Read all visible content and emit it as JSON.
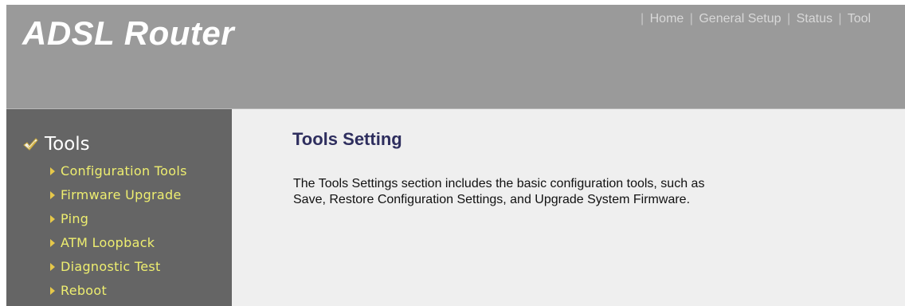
{
  "header": {
    "brand": "ADSL Router",
    "nav": [
      {
        "label": "Home"
      },
      {
        "label": "General Setup"
      },
      {
        "label": "Status"
      },
      {
        "label": "Tool"
      }
    ]
  },
  "sidebar": {
    "title": "Tools",
    "title_icon": "checkmark-icon",
    "item_icon": "arrow-right-icon",
    "items": [
      {
        "label": "Configuration Tools"
      },
      {
        "label": "Firmware Upgrade"
      },
      {
        "label": "Ping"
      },
      {
        "label": "ATM Loopback"
      },
      {
        "label": "Diagnostic Test"
      },
      {
        "label": "Reboot"
      }
    ]
  },
  "main": {
    "title": "Tools Setting",
    "description_line1": "The Tools Settings section includes the basic configuration tools, such as",
    "description_line2": "Save, Restore Configuration Settings, and Upgrade System Firmware."
  },
  "colors": {
    "header_bg": "#9a9a9a",
    "sidebar_bg": "#656565",
    "content_bg": "#efefef",
    "sidebar_link": "#eeee70",
    "title_color": "#2e2e5e"
  }
}
